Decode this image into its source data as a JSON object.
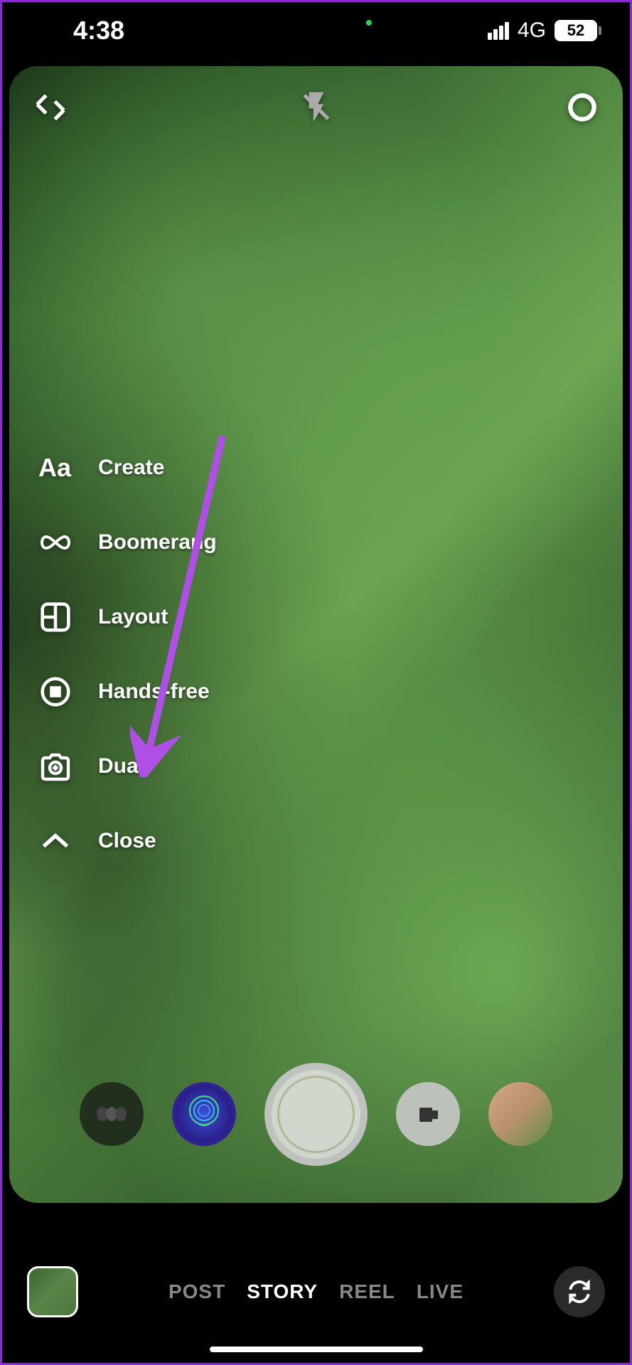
{
  "status_bar": {
    "time": "4:38",
    "network": "4G",
    "battery": "52"
  },
  "side_menu": {
    "create": "Create",
    "boomerang": "Boomerang",
    "layout": "Layout",
    "hands_free": "Hands-free",
    "dual": "Dual",
    "close": "Close"
  },
  "bottom_tabs": {
    "post": "POST",
    "story": "STORY",
    "reel": "REEL",
    "live": "LIVE"
  }
}
